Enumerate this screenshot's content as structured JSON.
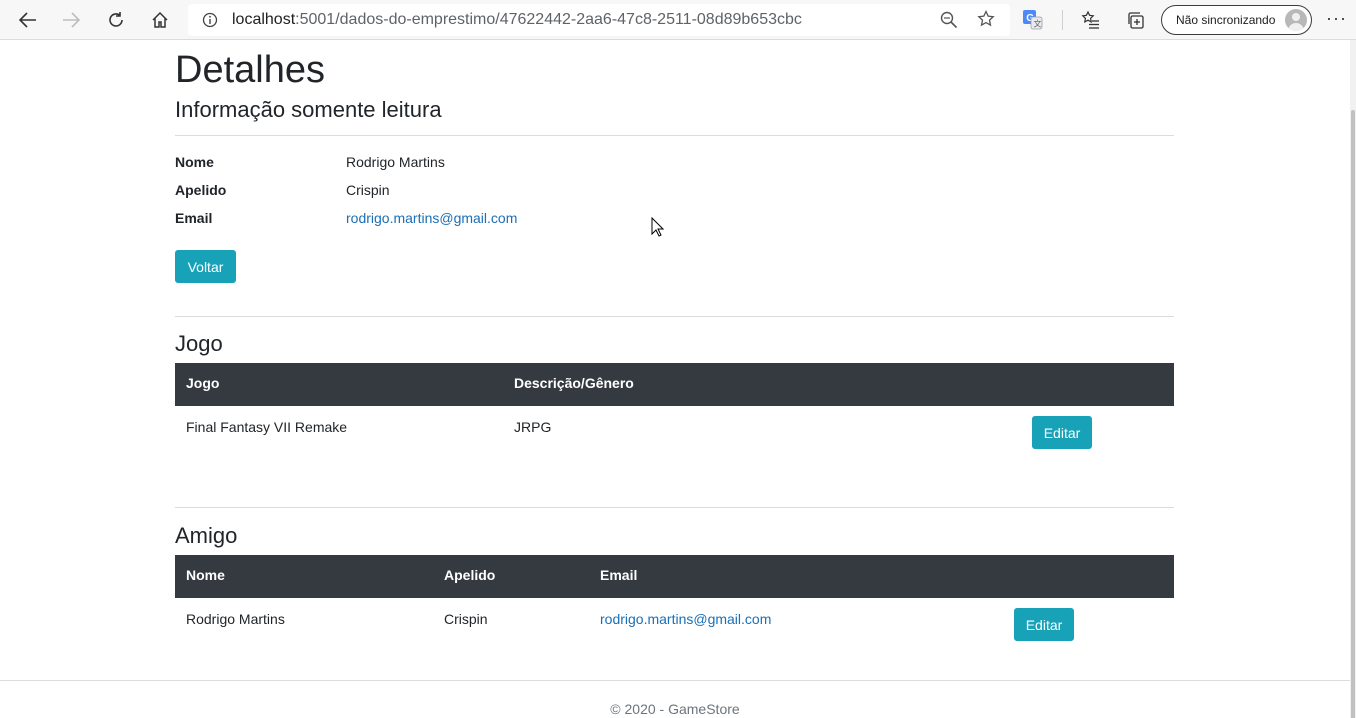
{
  "browser": {
    "url_host": "localhost",
    "url_path": ":5001/dados-do-emprestimo/47622442-2aa6-47c8-2511-08d89b653cbc",
    "profile_label": "Não sincronizando",
    "more_label": "···"
  },
  "page": {
    "title": "Detalhes",
    "subtitle": "Informação somente leitura",
    "details": [
      {
        "label": "Nome",
        "value": "Rodrigo Martins"
      },
      {
        "label": "Apelido",
        "value": "Crispin"
      },
      {
        "label": "Email",
        "value": "rodrigo.martins@gmail.com"
      }
    ],
    "back_button": "Voltar"
  },
  "jogo": {
    "section_title": "Jogo",
    "headers": [
      "Jogo",
      "Descrição/Gênero"
    ],
    "row": {
      "jogo": "Final Fantasy VII Remake",
      "genero": "JRPG"
    },
    "edit_button": "Editar"
  },
  "amigo": {
    "section_title": "Amigo",
    "headers": [
      "Nome",
      "Apelido",
      "Email"
    ],
    "row": {
      "nome": "Rodrigo Martins",
      "apelido": "Crispin",
      "email": "rodrigo.martins@gmail.com"
    },
    "edit_button": "Editar"
  },
  "footer": {
    "text": "© 2020 - GameStore"
  },
  "colors": {
    "accent": "#17a2b8",
    "table_header": "#343a40",
    "link": "#1a6fb5"
  }
}
